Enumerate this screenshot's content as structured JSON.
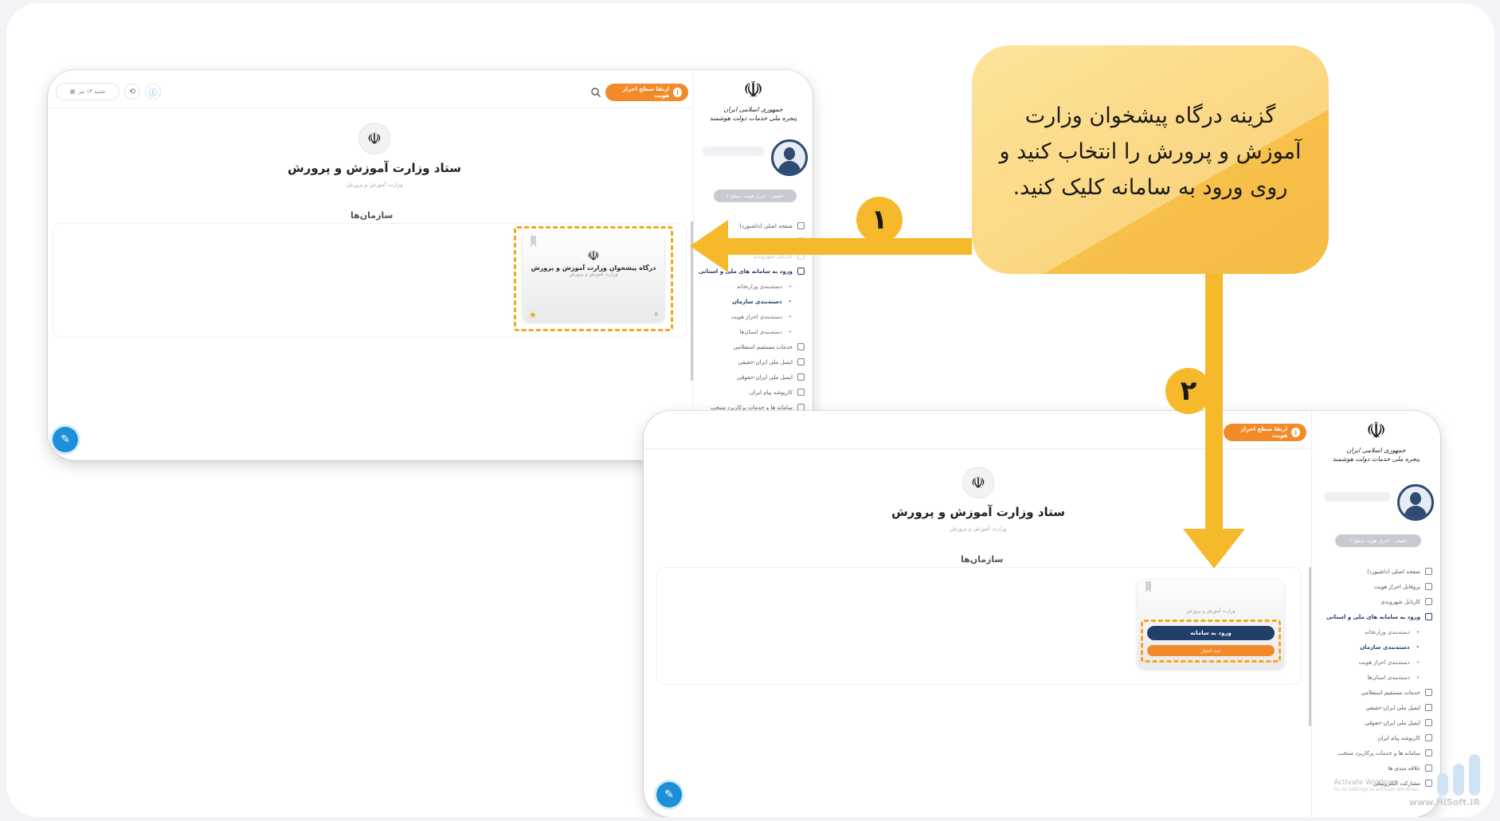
{
  "instruction": {
    "text": "گزینه درگاه پیشخوان وزارت آموزش و پرورش را انتخاب کنید و روی ورود به سامانه کلیک کنید.",
    "step1": "۱",
    "step2": "۲"
  },
  "colors": {
    "accent": "#f6b92c",
    "callout": "#fbd681",
    "navy": "#213f6b",
    "orange": "#f38a2a"
  },
  "screens": [
    {
      "topbar": {
        "identity_button": "ارتقا سطح احراز هویت",
        "date_text": "شنبه ۱۳ تیر"
      },
      "sidebar": {
        "emblem_caption_1": "جمهوری اسلامی ایران",
        "emblem_caption_2": "پنجره ملی خدمات دولت هوشمند",
        "auth_level": "حقیقی - احراز هویت سطح ۱",
        "menu": [
          "صفحه اصلی (داشبورد)",
          "پروفایل احراز هویت",
          "کارتابل شهروندی",
          "ورود به سامانه های ملی و استانی",
          "دسته‌بندی وزارتخانه",
          "دسته‌بندی سازمان",
          "دسته‌بندی احراز هویت",
          "دسته‌بندی استان‌ها",
          "خدمات مستقیم استعلامی",
          "ایمیل ملی ایران-حقیقی",
          "ایمیل ملی ایران-حقوقی",
          "کارپوشه پیام ایران",
          "سامانه ها و خدمات پرکاربرد منتخب",
          "علاقه مندی ها",
          "مشارکت الکترونیکی"
        ],
        "watermark_title": "Activate Windows",
        "watermark_sub": "Go to Settings to activate Windows."
      },
      "main": {
        "org_title": "ستاد وزارت آموزش و پرورش",
        "org_subtitle": "وزارت آموزش و پرورش",
        "section_title": "سازمان‌ها",
        "card_title": "درگاه پیشخوان وزارت آموزش و پرورش",
        "card_subtitle": "وزارت آموزش و پرورش",
        "card_counter": "8"
      }
    },
    {
      "card_enter_button": "ورود به سامانه",
      "card_rate_button": "ثبت امتیاز"
    }
  ],
  "branding": {
    "site": "www.HiSoft.IR"
  }
}
